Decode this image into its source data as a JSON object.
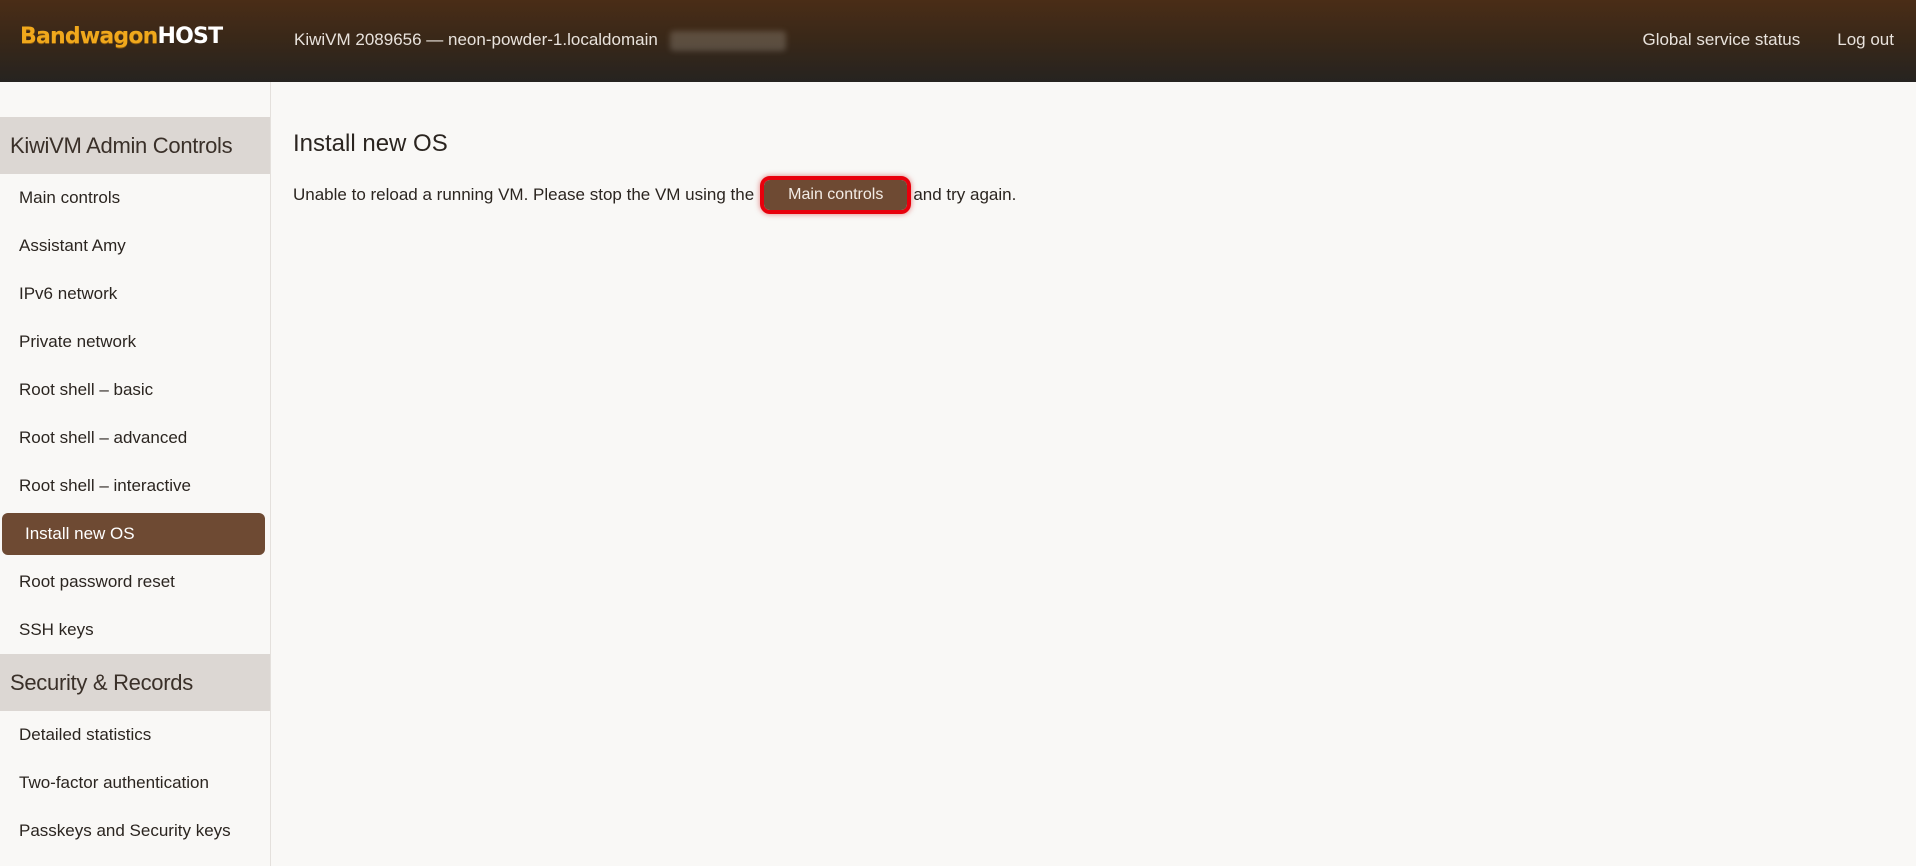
{
  "header": {
    "logo_main": "Bandwagon",
    "logo_host": "HOST",
    "vm_title": "KiwiVM 2089656 — neon-powder-1.localdomain",
    "links": [
      "Global service status",
      "Log out"
    ]
  },
  "sidebar": {
    "section1_title": "KiwiVM Admin Controls",
    "section1_items": [
      "Main controls",
      "Assistant Amy",
      "IPv6 network",
      "Private network",
      "Root shell – basic",
      "Root shell – advanced",
      "Root shell – interactive",
      "Install new OS",
      "Root password reset",
      "SSH keys"
    ],
    "active_item": "Install new OS",
    "section2_title": "Security & Records",
    "section2_items": [
      "Detailed statistics",
      "Two-factor authentication",
      "Passkeys and Security keys"
    ]
  },
  "main": {
    "title": "Install new OS",
    "msg_before": "Unable to reload a running VM. Please stop the VM using the",
    "button_label": "Main controls",
    "msg_after": "and try again."
  },
  "colors": {
    "accent": "#6e4a33",
    "logo": "#f0a81c",
    "highlight": "#e8000c"
  }
}
